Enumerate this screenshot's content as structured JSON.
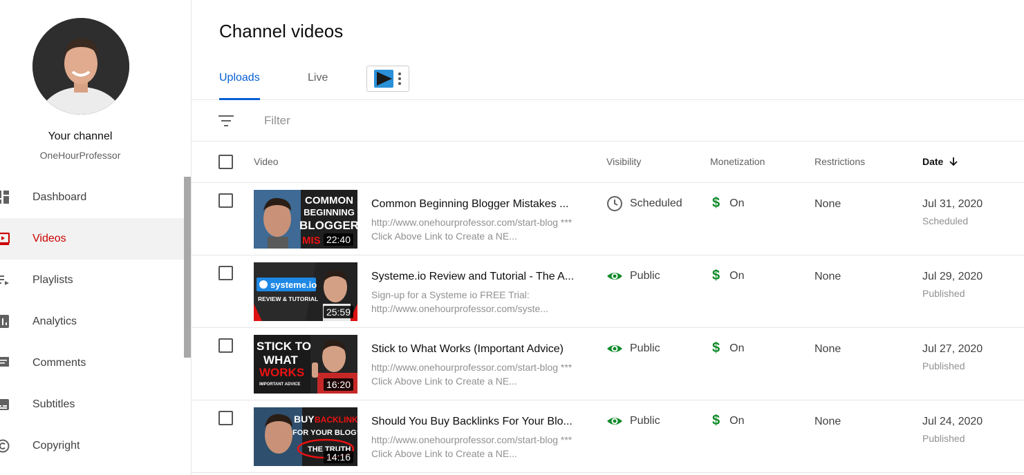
{
  "sidebar": {
    "channel_title": "Your channel",
    "channel_handle": "OneHourProfessor",
    "items": [
      {
        "label": "Dashboard",
        "icon": "dashboard-icon"
      },
      {
        "label": "Videos",
        "icon": "videos-icon"
      },
      {
        "label": "Playlists",
        "icon": "playlists-icon"
      },
      {
        "label": "Analytics",
        "icon": "analytics-icon"
      },
      {
        "label": "Comments",
        "icon": "comments-icon"
      },
      {
        "label": "Subtitles",
        "icon": "subtitles-icon"
      },
      {
        "label": "Copyright",
        "icon": "copyright-icon"
      }
    ],
    "active_item": "Videos"
  },
  "main": {
    "title": "Channel videos",
    "tabs": [
      {
        "label": "Uploads",
        "active": true
      },
      {
        "label": "Live",
        "active": false
      }
    ],
    "filter": {
      "placeholder": "Filter"
    },
    "columns": {
      "video": "Video",
      "visibility": "Visibility",
      "monetization": "Monetization",
      "restrictions": "Restrictions",
      "date": "Date"
    },
    "videos": [
      {
        "title": "Common Beginning Blogger Mistakes ...",
        "description": "http://www.onehourprofessor.com/start-blog *** Click Above Link to Create a NE...",
        "duration": "22:40",
        "thumb_text": [
          "COMMON",
          "BEGINNING",
          "BLOGGER",
          "MIS"
        ],
        "visibility": "Scheduled",
        "visibility_icon": "clock-icon",
        "monetization": "On",
        "restrictions": "None",
        "date": "Jul 31, 2020",
        "status": "Scheduled"
      },
      {
        "title": "Systeme.io Review and Tutorial - The A...",
        "description": "Sign-up for a Systeme io FREE Trial: http://www.onehourprofessor.com/syste...",
        "duration": "25:59",
        "thumb_text": [
          "systeme.io",
          "REVIEW & TUTORIAL"
        ],
        "visibility": "Public",
        "visibility_icon": "eye-icon",
        "monetization": "On",
        "restrictions": "None",
        "date": "Jul 29, 2020",
        "status": "Published"
      },
      {
        "title": "Stick to What Works (Important Advice)",
        "description": "http://www.onehourprofessor.com/start-blog *** Click Above Link to Create a NE...",
        "duration": "16:20",
        "thumb_text": [
          "STICK TO",
          "WHAT",
          "WORKS",
          "IMPORTANT ADVICE"
        ],
        "visibility": "Public",
        "visibility_icon": "eye-icon",
        "monetization": "On",
        "restrictions": "None",
        "date": "Jul 27, 2020",
        "status": "Published"
      },
      {
        "title": "Should You Buy Backlinks For Your Blo...",
        "description": "http://www.onehourprofessor.com/start-blog *** Click Above Link to Create a NE...",
        "duration": "14:16",
        "thumb_text": [
          "BUY",
          "BACKLINKS",
          "FOR YOUR BLOG?",
          "THE TRUTH"
        ],
        "visibility": "Public",
        "visibility_icon": "eye-icon",
        "monetization": "On",
        "restrictions": "None",
        "date": "Jul 24, 2020",
        "status": "Published"
      }
    ]
  },
  "colors": {
    "accent": "#065fd4",
    "active_nav": "#cc0000",
    "monetization_on": "#0f8a29",
    "public_eye": "#0f8a29"
  }
}
